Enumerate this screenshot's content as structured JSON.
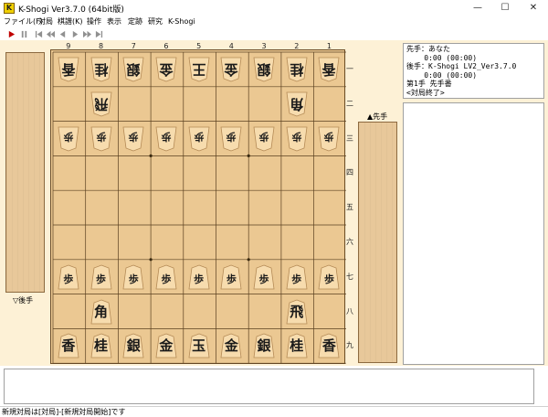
{
  "window": {
    "title": "K-Shogi Ver3.7.0 (64bit版)",
    "icon_letter": "K",
    "minimize": "—",
    "maximize": "☐",
    "close": "✕"
  },
  "menu": [
    "ファイル(F)",
    "対局",
    "棋譜(K)",
    "操作",
    "表示",
    "定跡",
    "研究",
    "K-Shogi"
  ],
  "toolbar": [
    "play-icon",
    "pause-icon",
    "first-icon",
    "prev-all-icon",
    "prev-icon",
    "next-icon",
    "next-all-icon",
    "last-icon"
  ],
  "board": {
    "files": [
      "9",
      "8",
      "7",
      "6",
      "5",
      "4",
      "3",
      "2",
      "1"
    ],
    "ranks": [
      "一",
      "二",
      "三",
      "四",
      "五",
      "六",
      "七",
      "八",
      "九"
    ],
    "gote_rank1": [
      "香",
      "桂",
      "銀",
      "金",
      "王",
      "金",
      "銀",
      "桂",
      "香"
    ],
    "gote_rank2": [
      {
        "file": 8,
        "piece": "飛"
      },
      {
        "file": 2,
        "piece": "角"
      }
    ],
    "gote_rank3": [
      "歩",
      "歩",
      "歩",
      "歩",
      "歩",
      "歩",
      "歩",
      "歩",
      "歩"
    ],
    "sente_rank7": [
      "歩",
      "歩",
      "歩",
      "歩",
      "歩",
      "歩",
      "歩",
      "歩",
      "歩"
    ],
    "sente_rank8": [
      {
        "file": 8,
        "piece": "角"
      },
      {
        "file": 2,
        "piece": "飛"
      }
    ],
    "sente_rank9": [
      "香",
      "桂",
      "銀",
      "金",
      "玉",
      "金",
      "銀",
      "桂",
      "香"
    ]
  },
  "labels": {
    "gote_stand": "▽後手",
    "sente_stand": "▲先手"
  },
  "info": {
    "line1": "先手：あなた",
    "line2": "    0:00 (00:00)",
    "line3": "後手：K-Shogi LV2_Ver3.7.0",
    "line4": "    0:00 (00:00)",
    "line5": "第1手 先手番",
    "line6": "<対局終了>"
  },
  "status": "新規対局は[対局]-[新規対局開始]です",
  "colors": {
    "background": "#fdf1d6",
    "board": "#ebc892",
    "piece": "#f7dcae",
    "stand": "#e8c89a"
  }
}
